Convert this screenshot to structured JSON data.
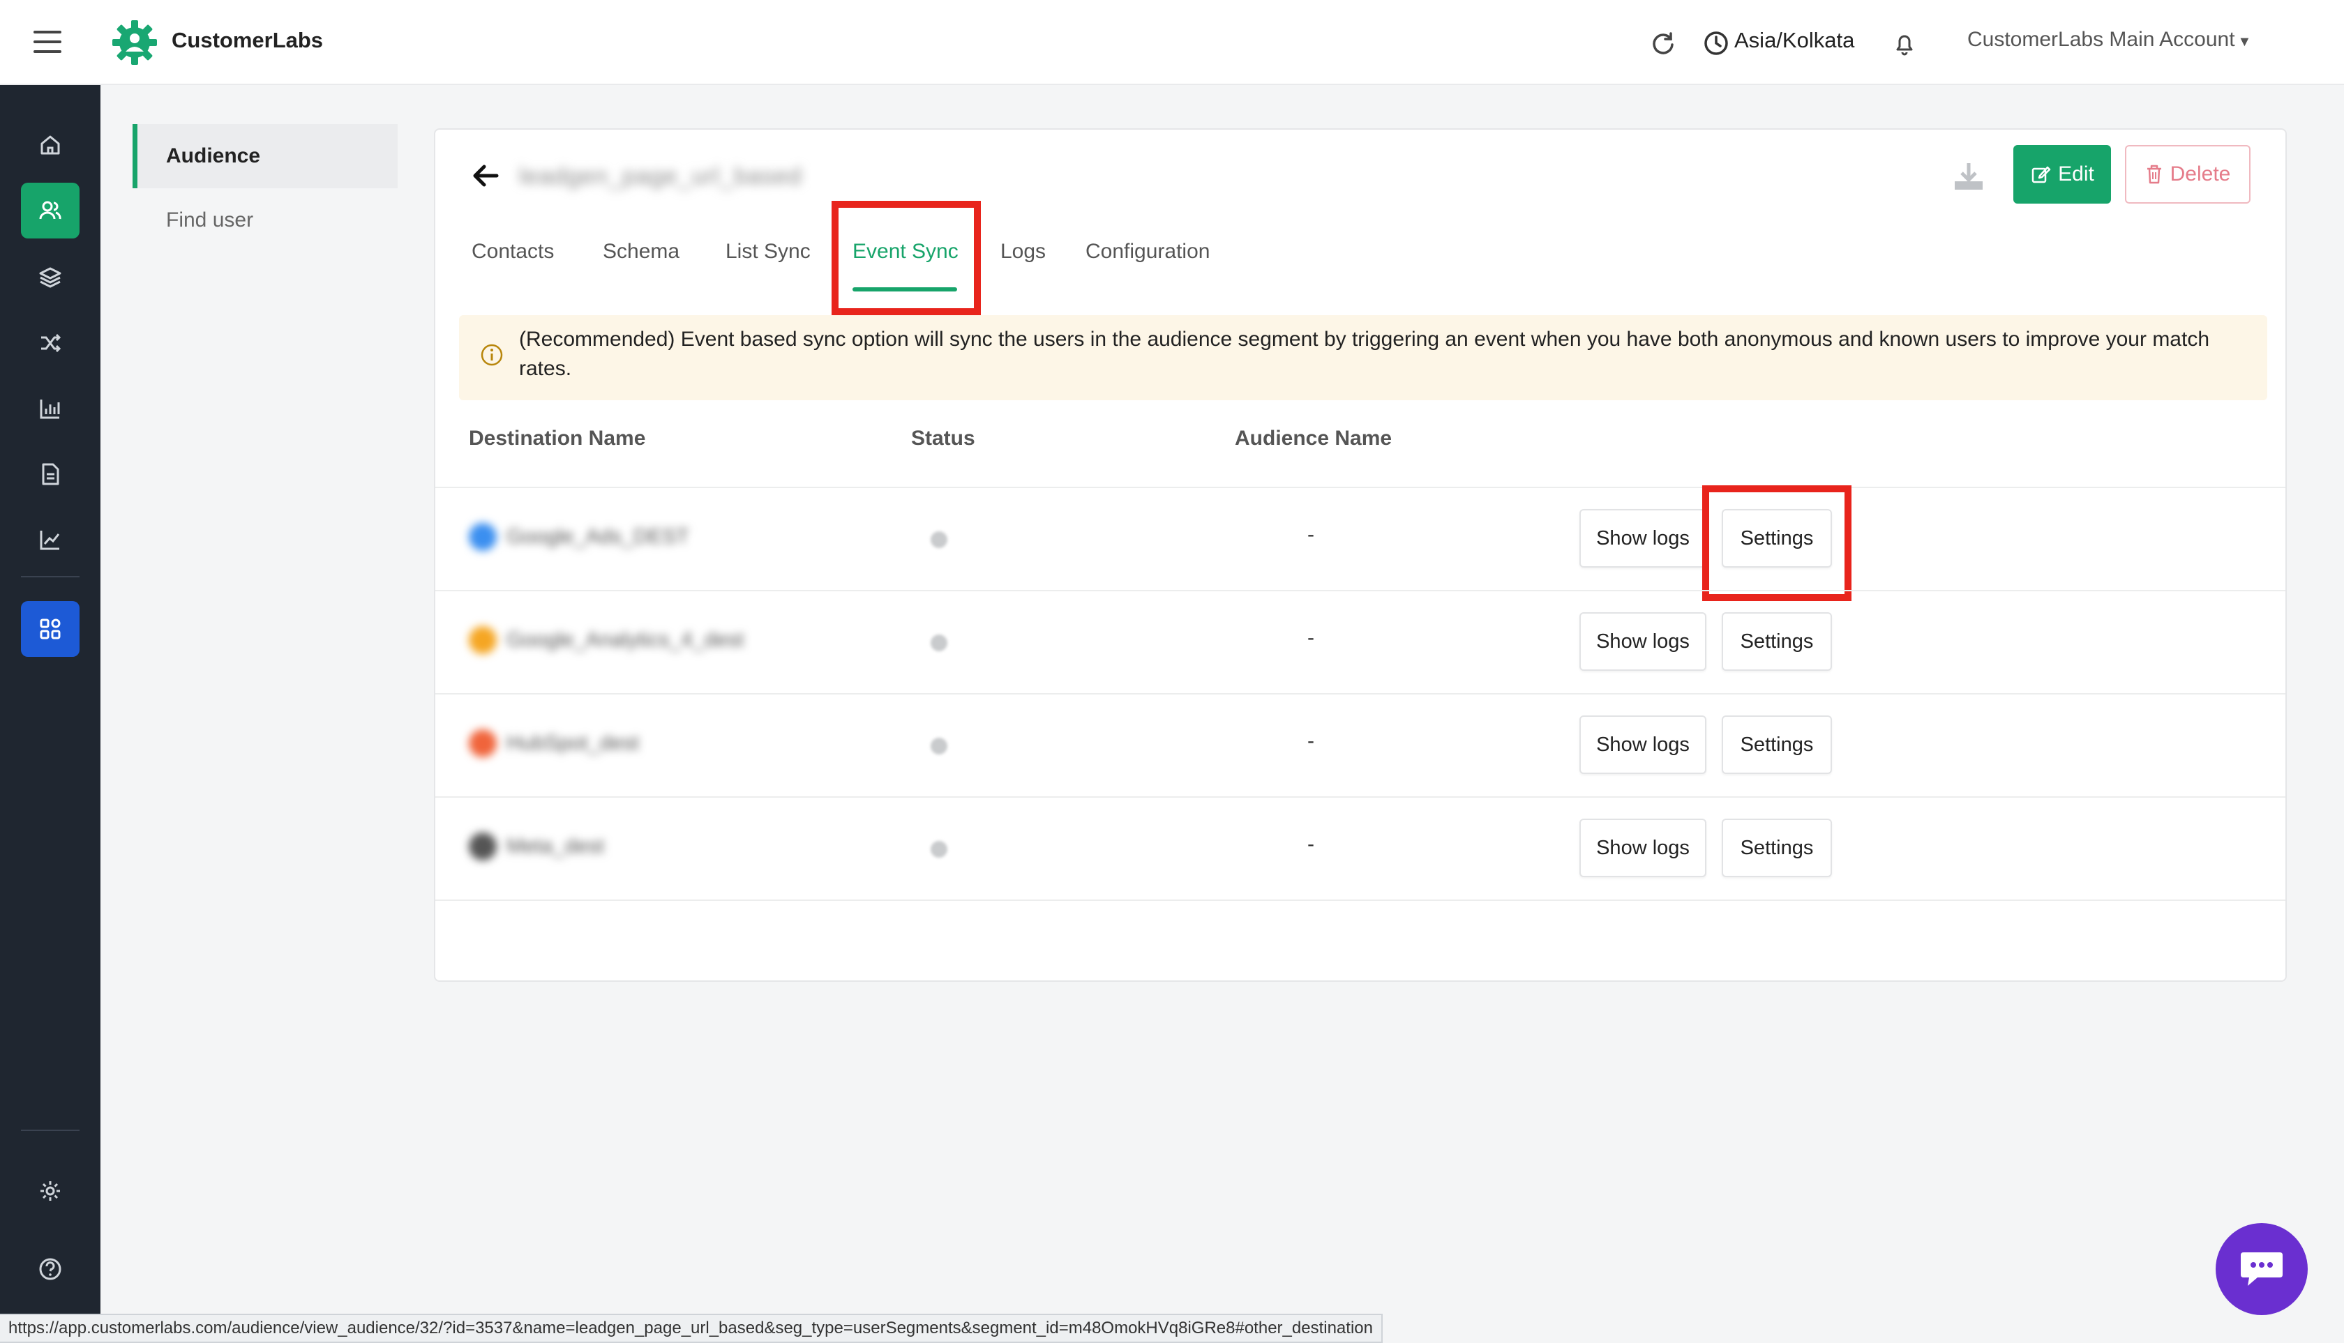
{
  "app": {
    "brand": "CustomerLabs",
    "timezone": "Asia/Kolkata",
    "account": "CustomerLabs Main Account"
  },
  "colors": {
    "accent": "#17a46a",
    "sidebar_bg": "#1f2630",
    "apps_active": "#1d5ad6",
    "highlight_box": "#e8241c",
    "chat": "#6a2fd0"
  },
  "sidebar": {
    "icons": [
      "home-icon",
      "users-icon",
      "layers-icon",
      "shuffle-icon",
      "bar-chart-icon",
      "document-icon",
      "line-chart-icon",
      "apps-grid-icon",
      "gear-icon",
      "help-icon"
    ]
  },
  "subnav": {
    "items": [
      "Audience",
      "Find user"
    ]
  },
  "audience": {
    "title": "leadgen_page_url_based",
    "edit_label": "Edit",
    "delete_label": "Delete"
  },
  "tabs": [
    "Contacts",
    "Schema",
    "List Sync",
    "Event Sync",
    "Logs",
    "Configuration"
  ],
  "notice": {
    "text": "(Recommended) Event based sync option will sync the users in the audience segment by triggering an event when you have both anonymous and known users to improve your match rates."
  },
  "table": {
    "headers": [
      "Destination Name",
      "Status",
      "Audience Name"
    ],
    "rows": [
      {
        "destination": "Google_Ads_DEST",
        "audience": "-",
        "logs_label": "Show logs",
        "settings_label": "Settings"
      },
      {
        "destination": "Google_Analytics_4_dest",
        "audience": "-",
        "logs_label": "Show logs",
        "settings_label": "Settings"
      },
      {
        "destination": "HubSpot_dest",
        "audience": "-",
        "logs_label": "Show logs",
        "settings_label": "Settings"
      },
      {
        "destination": "Meta_dest",
        "audience": "-",
        "logs_label": "Show logs",
        "settings_label": "Settings"
      }
    ]
  },
  "statusbar": {
    "url": "https://app.customerlabs.com/audience/view_audience/32/?id=3537&name=leadgen_page_url_based&seg_type=userSegments&segment_id=m48OmokHVq8iGRe8#other_destination"
  }
}
